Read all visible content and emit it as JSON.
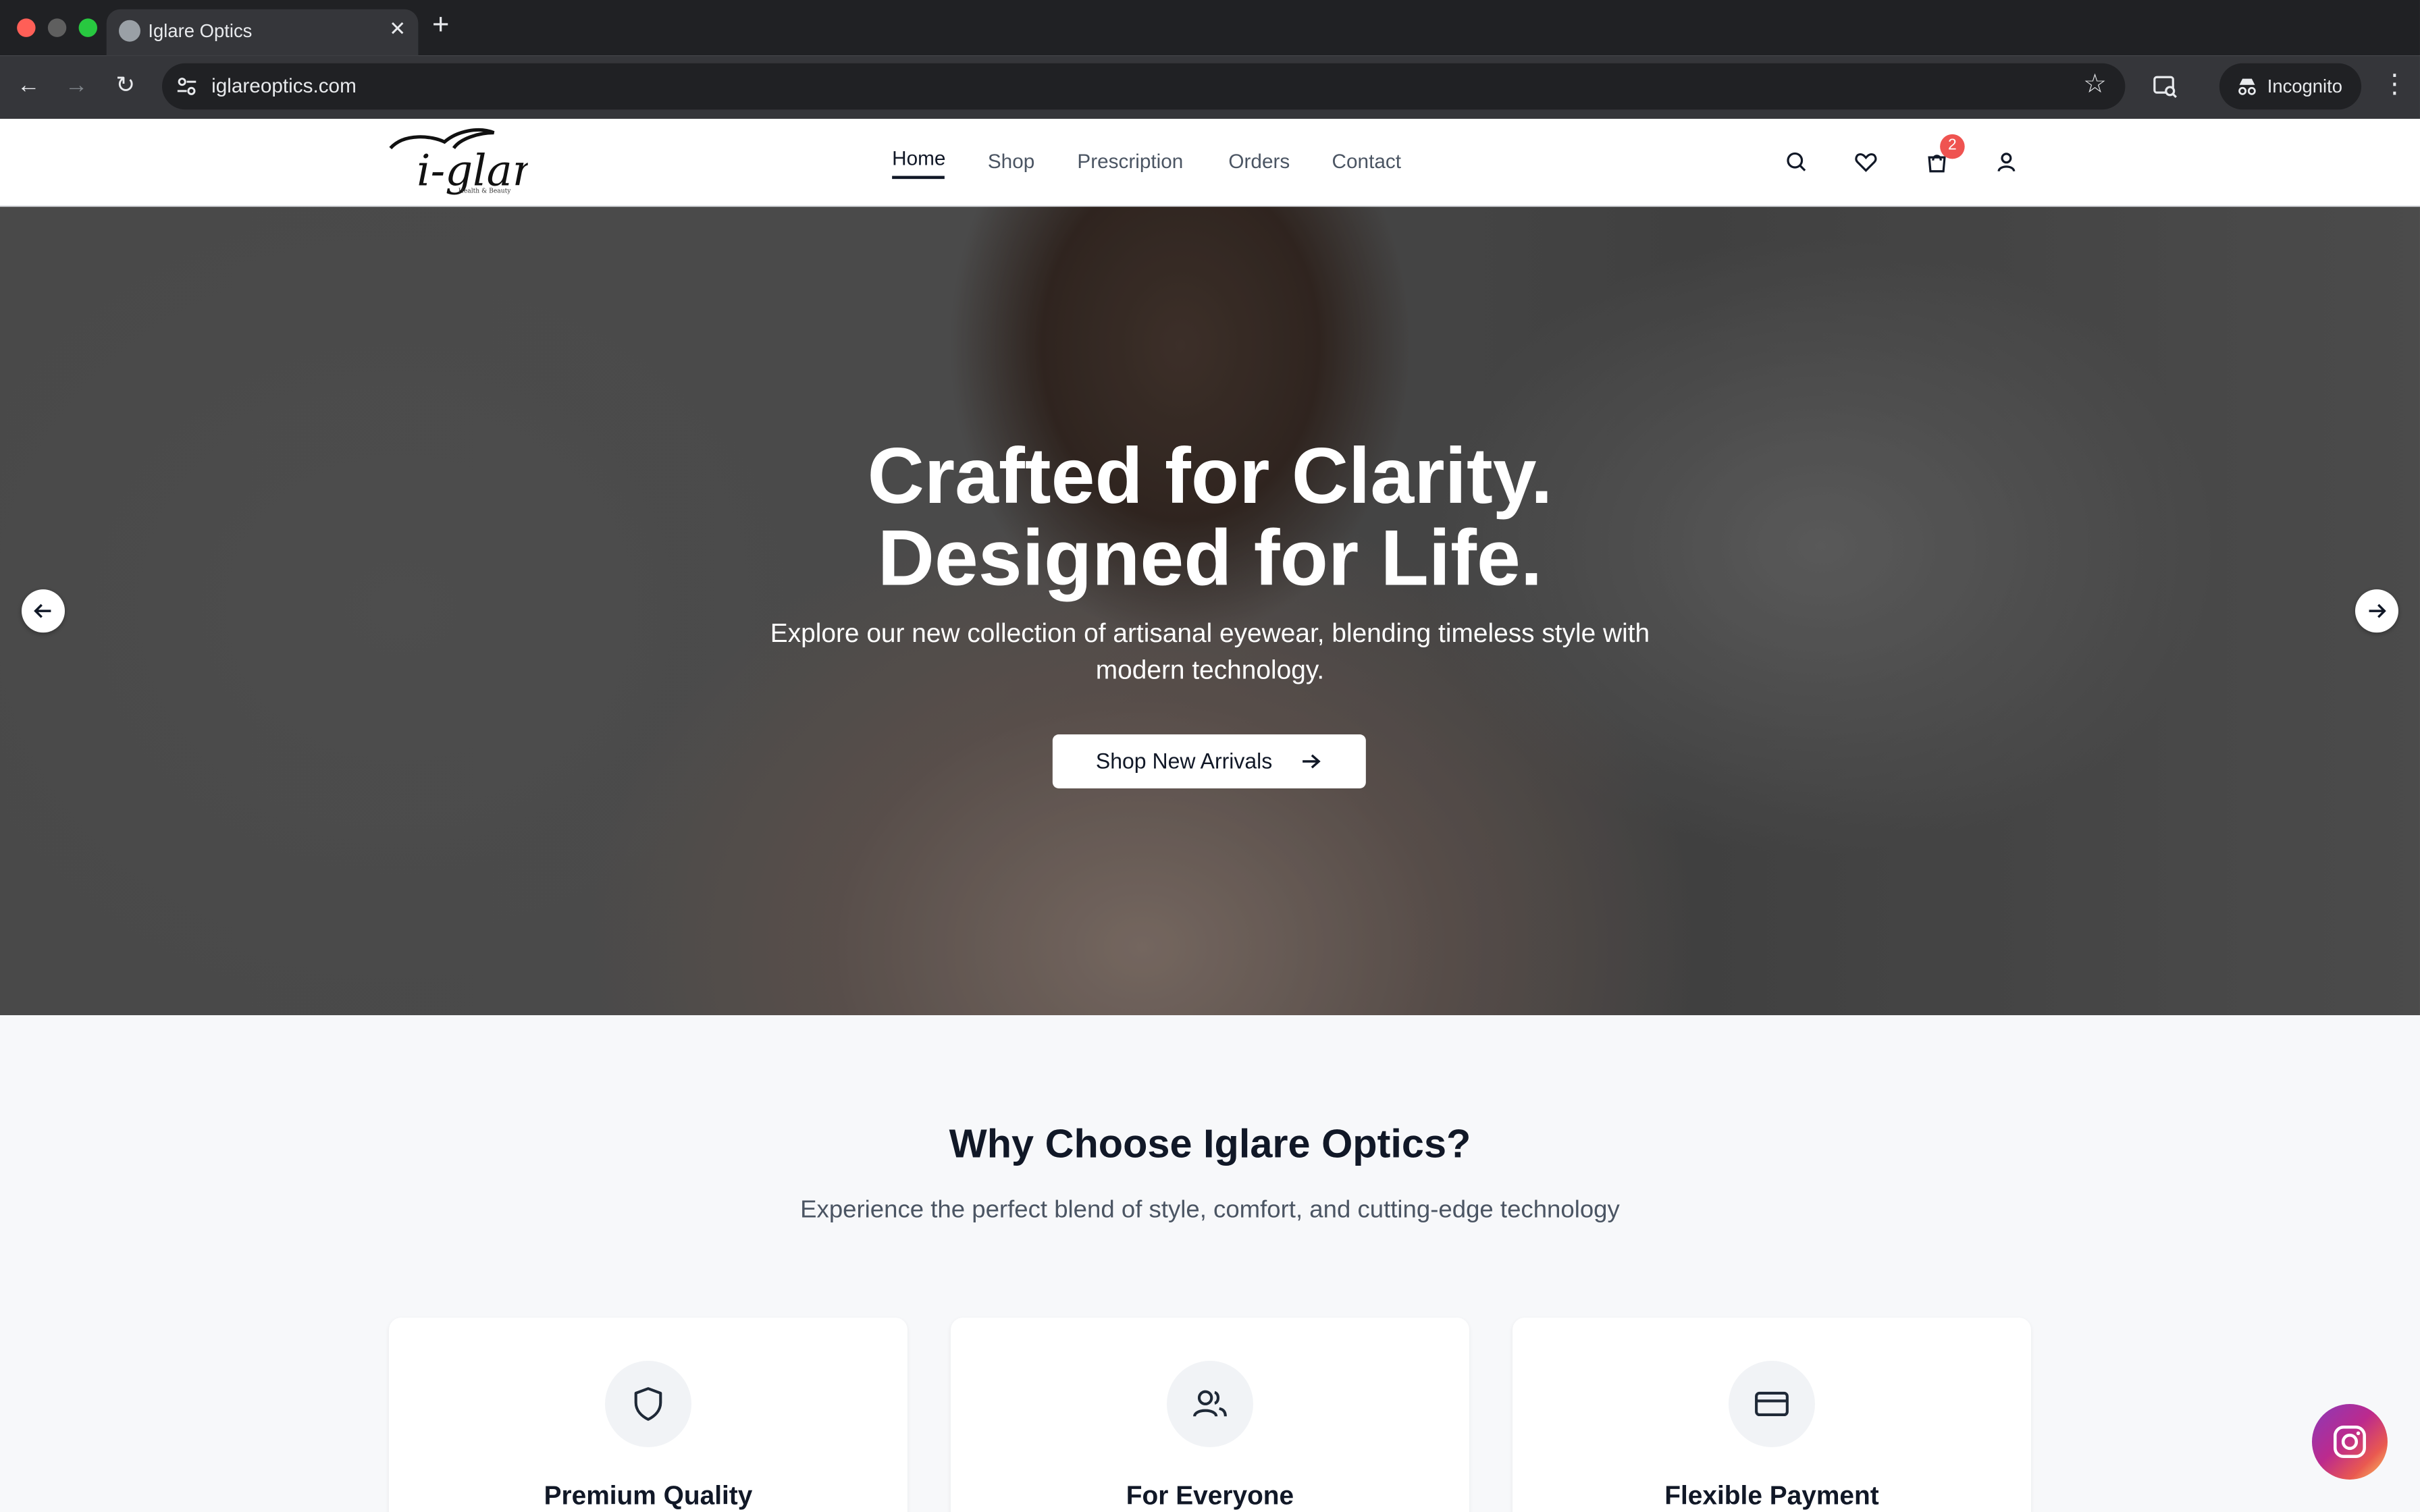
{
  "browser": {
    "tab_title": "Iglare Optics",
    "tab_close": "✕",
    "new_tab": "+",
    "url": "iglareoptics.com",
    "profile_label": "Incognito"
  },
  "header": {
    "logo_text": "i-glare",
    "logo_tagline": "Health & Beauty",
    "nav": [
      {
        "label": "Home",
        "active": true
      },
      {
        "label": "Shop"
      },
      {
        "label": "Prescription"
      },
      {
        "label": "Orders"
      },
      {
        "label": "Contact"
      }
    ],
    "cart_count": "2",
    "icons": [
      "search-icon",
      "heart-icon",
      "cart-icon",
      "user-icon"
    ]
  },
  "hero": {
    "title_line1": "Crafted for Clarity.",
    "title_line2": "Designed for Life.",
    "subtitle": "Explore our new collection of artisanal eyewear, blending timeless style with modern technology.",
    "cta_label": "Shop New Arrivals"
  },
  "why": {
    "title": "Why Choose Iglare Optics?",
    "subtitle": "Experience the perfect blend of style, comfort, and cutting-edge technology",
    "cards": [
      {
        "title": "Premium Quality",
        "icon": "shield-icon"
      },
      {
        "title": "For Everyone",
        "icon": "users-icon"
      },
      {
        "title": "Flexible Payment",
        "icon": "credit-card-icon"
      }
    ]
  },
  "colors": {
    "text_dark": "#111827",
    "badge": "#ef5350",
    "chrome_bg": "#202124"
  }
}
